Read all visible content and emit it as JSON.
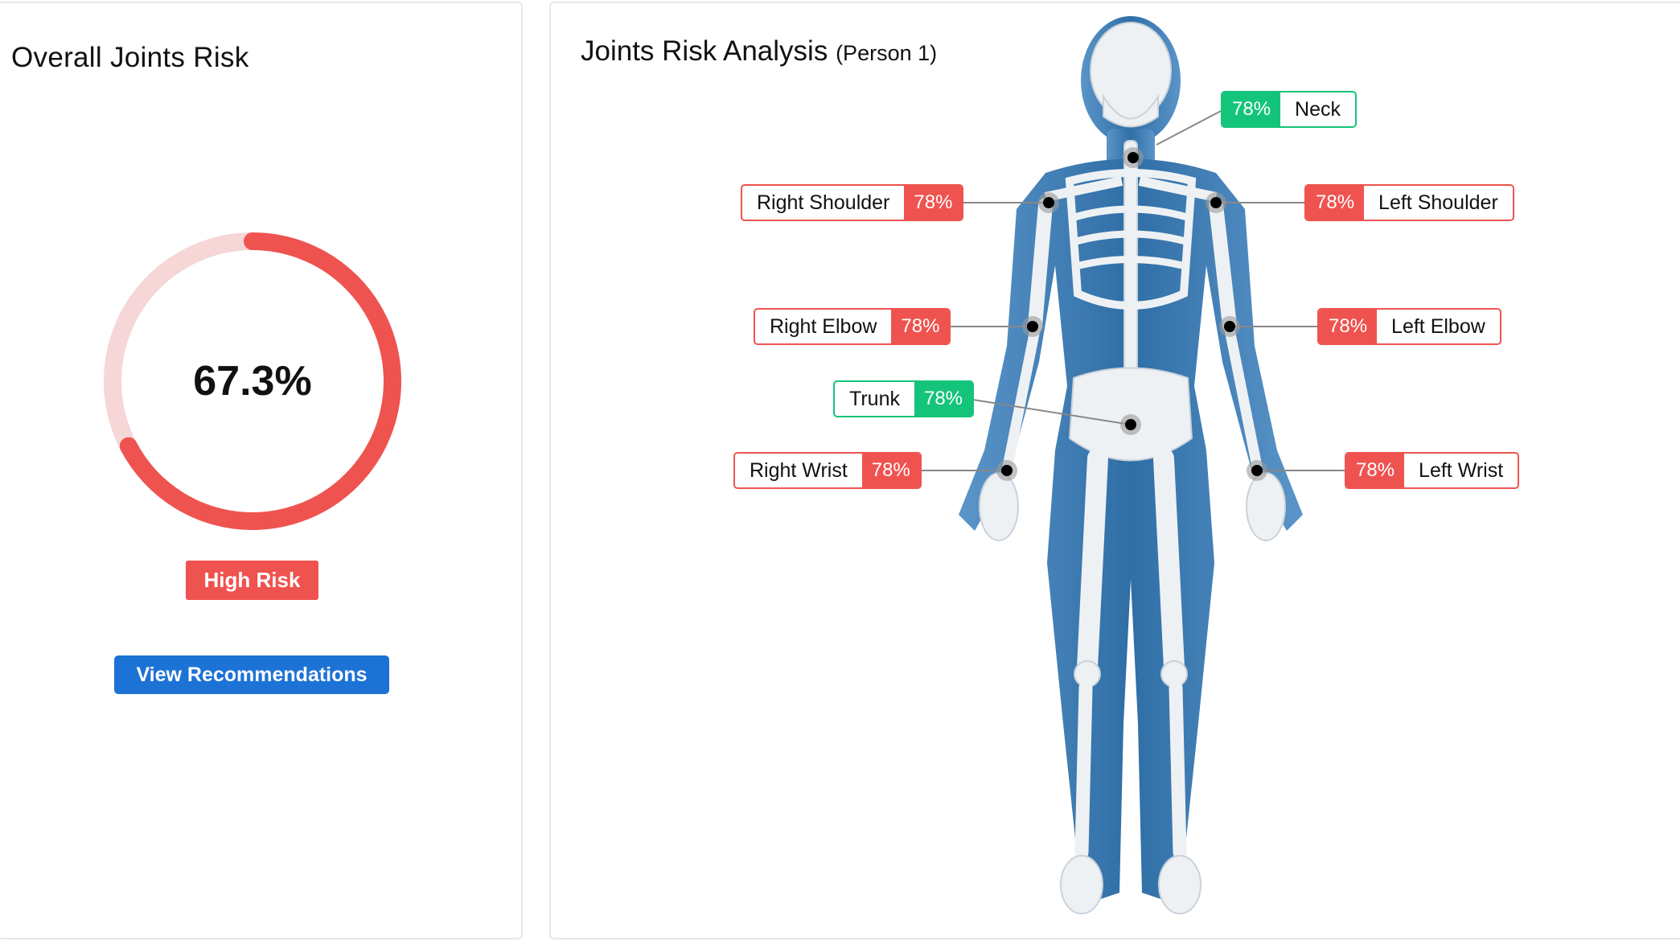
{
  "left_panel": {
    "title": "Overall Joints Risk",
    "gauge": {
      "value": 0.673,
      "value_label": "67.3%",
      "color": "#ef5350",
      "track_color": "#f6d6d6"
    },
    "risk_badge": "High Risk",
    "recommendations_button": "View Recommendations"
  },
  "right_panel": {
    "title": "Joints Risk Analysis",
    "subtitle": "(Person 1)",
    "joints": {
      "neck": {
        "name": "Neck",
        "value": "78%",
        "status": "green"
      },
      "right_shoulder": {
        "name": "Right Shoulder",
        "value": "78%",
        "status": "red"
      },
      "left_shoulder": {
        "name": "Left Shoulder",
        "value": "78%",
        "status": "red"
      },
      "right_elbow": {
        "name": "Right Elbow",
        "value": "78%",
        "status": "red"
      },
      "left_elbow": {
        "name": "Left Elbow",
        "value": "78%",
        "status": "red"
      },
      "trunk": {
        "name": "Trunk",
        "value": "78%",
        "status": "green"
      },
      "right_wrist": {
        "name": "Right Wrist",
        "value": "78%",
        "status": "red"
      },
      "left_wrist": {
        "name": "Left Wrist",
        "value": "78%",
        "status": "red"
      }
    }
  },
  "colors": {
    "high_risk": "#ef5350",
    "low_risk": "#14c47a",
    "button_blue": "#1d72d6",
    "body_blue": "#3f7fb8",
    "bone": "#eef1f3"
  }
}
